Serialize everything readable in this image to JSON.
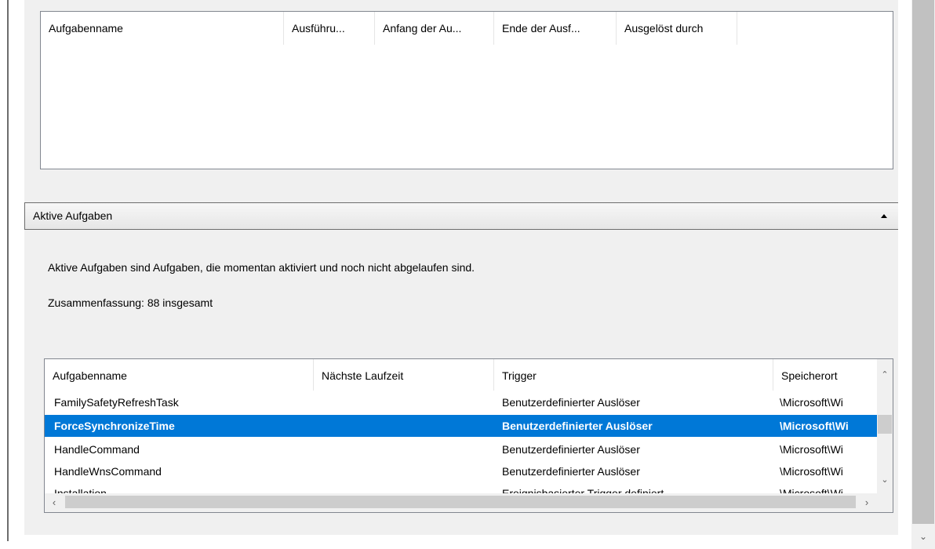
{
  "history_table": {
    "columns": [
      "Aufgabenname",
      "Ausführu...",
      "Anfang der Au...",
      "Ende der Ausf...",
      "Ausgelöst durch"
    ]
  },
  "active_section": {
    "title": "Aktive Aufgaben",
    "description": "Aktive Aufgaben sind Aufgaben, die momentan aktiviert und noch nicht abgelaufen sind.",
    "summary": "Zusammenfassung: 88 insgesamt"
  },
  "active_table": {
    "columns": [
      "Aufgabenname",
      "Nächste Laufzeit",
      "Trigger",
      "Speicherort"
    ],
    "rows": [
      {
        "name": "FamilySafetyRefreshTask",
        "next": "",
        "trigger": "Benutzerdefinierter Auslöser",
        "location": "\\Microsoft\\Wi"
      },
      {
        "name": "ForceSynchronizeTime",
        "next": "",
        "trigger": "Benutzerdefinierter Auslöser",
        "location": "\\Microsoft\\Wi",
        "selected": true
      },
      {
        "name": "HandleCommand",
        "next": "",
        "trigger": "Benutzerdefinierter Auslöser",
        "location": "\\Microsoft\\Wi"
      },
      {
        "name": "HandleWnsCommand",
        "next": "",
        "trigger": "Benutzerdefinierter Auslöser",
        "location": "\\Microsoft\\Wi"
      },
      {
        "name": "Installation",
        "next": "",
        "trigger": "Ereignisbasierter Trigger definiert",
        "location": "\\Microsoft\\Wi"
      }
    ]
  },
  "colors": {
    "selection": "#0078d7",
    "panel": "#f0f0f0",
    "border": "#828790"
  },
  "icons": {
    "collapse": "chevron-up-icon",
    "scroll_up": "chevron-up-icon",
    "scroll_down": "chevron-down-icon",
    "scroll_left": "chevron-left-icon",
    "scroll_right": "chevron-right-icon"
  }
}
